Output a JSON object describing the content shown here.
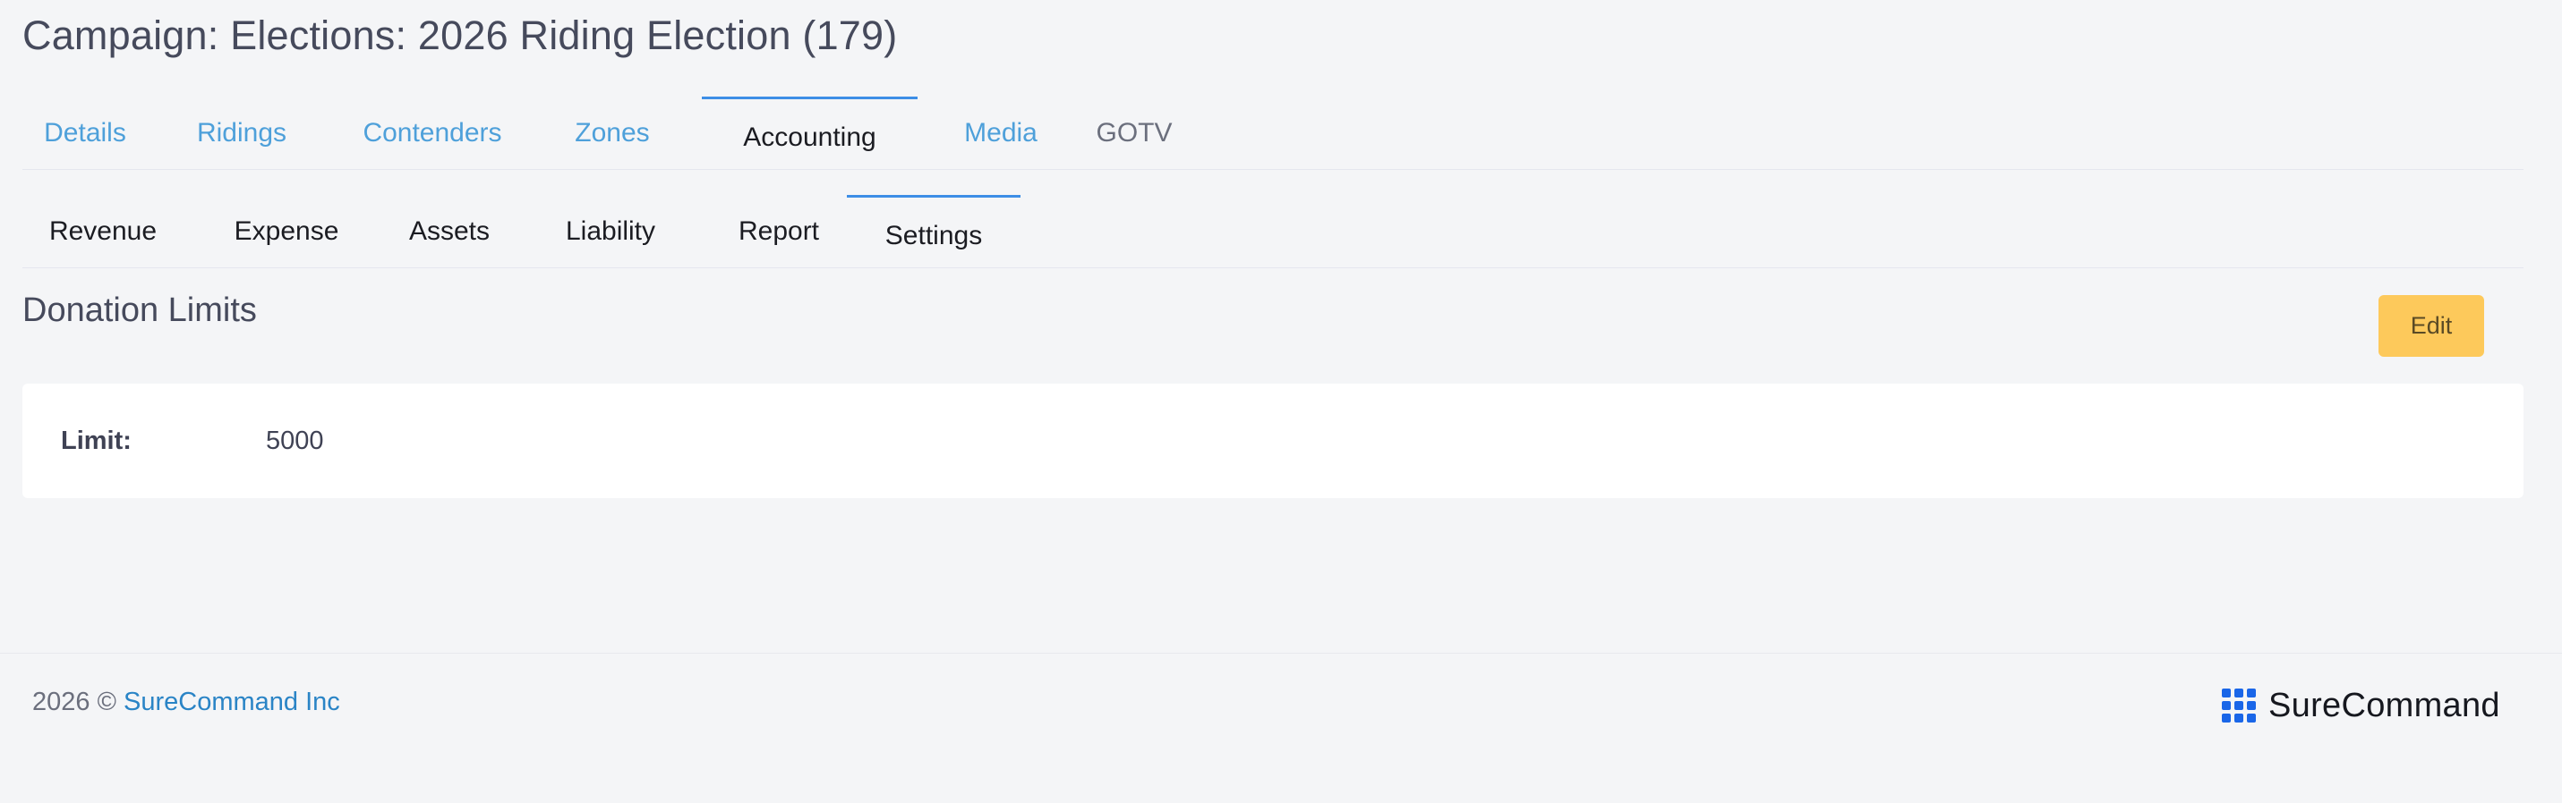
{
  "page": {
    "title": "Campaign: Elections: 2026 Riding Election (179)"
  },
  "tabs": {
    "primary": [
      {
        "label": "Details"
      },
      {
        "label": "Ridings"
      },
      {
        "label": "Contenders"
      },
      {
        "label": "Zones"
      },
      {
        "label": "Accounting",
        "active": true
      },
      {
        "label": "Media"
      },
      {
        "label": "GOTV"
      }
    ],
    "secondary": [
      {
        "label": "Revenue"
      },
      {
        "label": "Expense"
      },
      {
        "label": "Assets"
      },
      {
        "label": "Liability"
      },
      {
        "label": "Report"
      },
      {
        "label": "Settings",
        "active": true
      }
    ]
  },
  "section": {
    "title": "Donation Limits",
    "edit_label": "Edit",
    "fields": {
      "limit_label": "Limit:",
      "limit_value": "5000"
    }
  },
  "footer": {
    "year_text": "2026 ©",
    "company_link": "SureCommand Inc",
    "brand_name": "SureCommand",
    "brand_icon": "grid-icon"
  },
  "colors": {
    "accent": "#3d8ee6",
    "link": "#4ea0da",
    "edit_button": "#fdc95b",
    "brand": "#1a66e8"
  }
}
